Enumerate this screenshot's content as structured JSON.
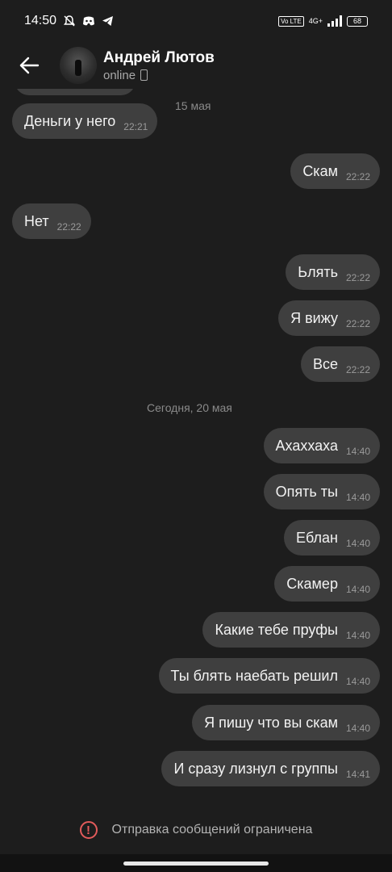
{
  "status_bar": {
    "time": "14:50",
    "network": "4G+",
    "lte": "Vo LTE",
    "battery": "68",
    "icons": [
      "mute-bell-icon",
      "discord-icon",
      "telegram-icon"
    ]
  },
  "header": {
    "name": "Андрей Лютов",
    "status": "online",
    "status_icon": "phone-icon"
  },
  "messages": [
    {
      "text": "Деньги у него",
      "time": "22:21",
      "dir": "in"
    },
    {
      "text": "Скам",
      "time": "22:22",
      "dir": "out"
    },
    {
      "text": "Нет",
      "time": "22:22",
      "dir": "in"
    },
    {
      "text": "Ьлять",
      "time": "22:22",
      "dir": "out"
    },
    {
      "text": "Я вижу",
      "time": "22:22",
      "dir": "out"
    },
    {
      "text": "Все",
      "time": "22:22",
      "dir": "out"
    },
    {
      "text": "Ахаххаха",
      "time": "14:40",
      "dir": "out"
    },
    {
      "text": "Опять ты",
      "time": "14:40",
      "dir": "out"
    },
    {
      "text": "Еблан",
      "time": "14:40",
      "dir": "out"
    },
    {
      "text": "Скамер",
      "time": "14:40",
      "dir": "out"
    },
    {
      "text": "Какие тебе пруфы",
      "time": "14:40",
      "dir": "out"
    },
    {
      "text": "Ты блять наебать решил",
      "time": "14:40",
      "dir": "out"
    },
    {
      "text": "Я пишу что вы скам",
      "time": "14:40",
      "dir": "out"
    },
    {
      "text": "И сразу лизнул с группы",
      "time": "14:41",
      "dir": "out"
    }
  ],
  "date_separators": {
    "first": "15 мая",
    "second": "Сегодня, 20 мая"
  },
  "footer": {
    "restriction_text": "Отправка сообщений ограничена",
    "icon": "warning-icon",
    "icon_color": "#e25b5b"
  },
  "colors": {
    "background": "#1d1d1d",
    "bubble": "#3f3f3f"
  }
}
